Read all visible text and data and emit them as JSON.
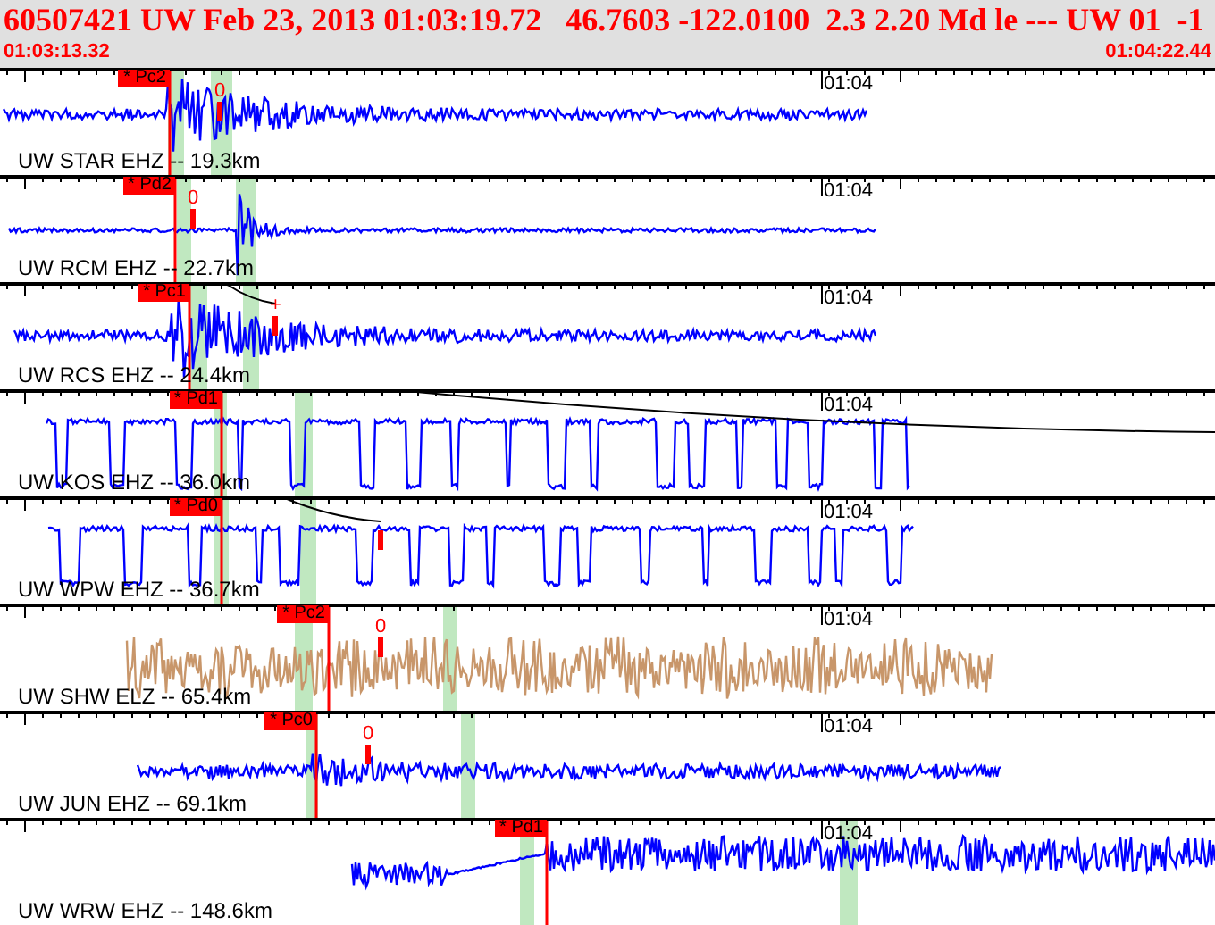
{
  "header": {
    "event_line": "60507421 UW Feb 23, 2013 01:03:19.72   46.7603 -122.0100  2.3 2.20 Md le --- UW 01  -1",
    "start_time": "01:03:13.32",
    "end_time": "01:04:22.44"
  },
  "panels": [
    {
      "station": "UW STAR EHZ -- 19.3km",
      "time_label": "01:04",
      "pick": "* Pc2",
      "mark": "0",
      "color": "#0000ff"
    },
    {
      "station": "UW RCM EHZ -- 22.7km",
      "time_label": "01:04",
      "pick": "* Pd2",
      "mark": "0",
      "color": "#0000ff"
    },
    {
      "station": "UW RCS EHZ -- 24.4km",
      "time_label": "01:04",
      "pick": "* Pc1",
      "mark": "+",
      "color": "#0000ff"
    },
    {
      "station": "UW KOS EHZ -- 36.0km",
      "time_label": "01:04",
      "pick": "* Pd1",
      "color": "#0000ff"
    },
    {
      "station": "UW WPW EHZ -- 36.7km",
      "time_label": "01:04",
      "pick": "* Pd0",
      "color": "#0000ff"
    },
    {
      "station": "UW SHW ELZ -- 65.4km",
      "time_label": "01:04",
      "pick": "* Pc2",
      "mark": "0",
      "color": "#c8966a"
    },
    {
      "station": "UW JUN EHZ -- 69.1km",
      "time_label": "01:04",
      "pick": "* Pc0",
      "mark": "0",
      "color": "#0000ff"
    },
    {
      "station": "UW WRW EHZ -- 148.6km",
      "time_label": "01:04",
      "pick": "* Pd1",
      "color": "#0000ff"
    }
  ]
}
